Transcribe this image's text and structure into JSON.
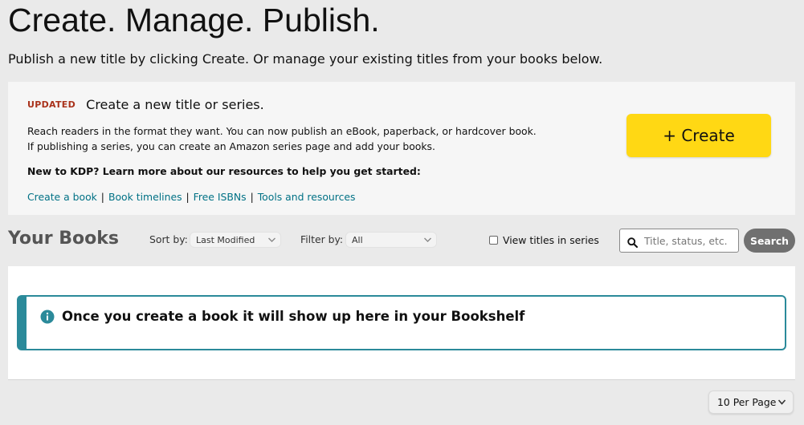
{
  "header": {
    "title": "Create. Manage. Publish.",
    "subtitle": "Publish a new title by clicking Create. Or manage your existing titles from your books below."
  },
  "create_panel": {
    "badge": "UPDATED",
    "heading": "Create a new title or series.",
    "description": "Reach readers in the format they want. You can now publish an eBook, paperback, or hardcover book. If publishing a series, you can create an Amazon series page and add your books.",
    "new_to_kdp": "New to KDP? Learn more about our resources to help you get started:",
    "links": [
      "Create a book",
      "Book timelines",
      "Free ISBNs",
      "Tools and resources"
    ],
    "link_separator": "|",
    "create_button": "+ Create"
  },
  "books": {
    "title": "Your Books",
    "sort_label": "Sort by:",
    "sort_value": "Last Modified",
    "filter_label": "Filter by:",
    "filter_value": "All",
    "series_toggle_label": "View titles in series",
    "series_toggle_checked": false,
    "search_placeholder": "Title, status, etc.",
    "search_value": "",
    "search_button": "Search",
    "empty_message": "Once you create a book it will show up here in your Bookshelf",
    "per_page": "10 Per Page"
  },
  "icons": {
    "search": "search-icon",
    "info": "info-icon",
    "chevron": "chevron-down-icon"
  },
  "colors": {
    "page_bg": "#eaeaea",
    "create_button_bg": "#ffd814",
    "badge": "#a9321b",
    "link": "#007185",
    "alert_border": "#2b8a9a",
    "search_button_bg": "#707070"
  }
}
